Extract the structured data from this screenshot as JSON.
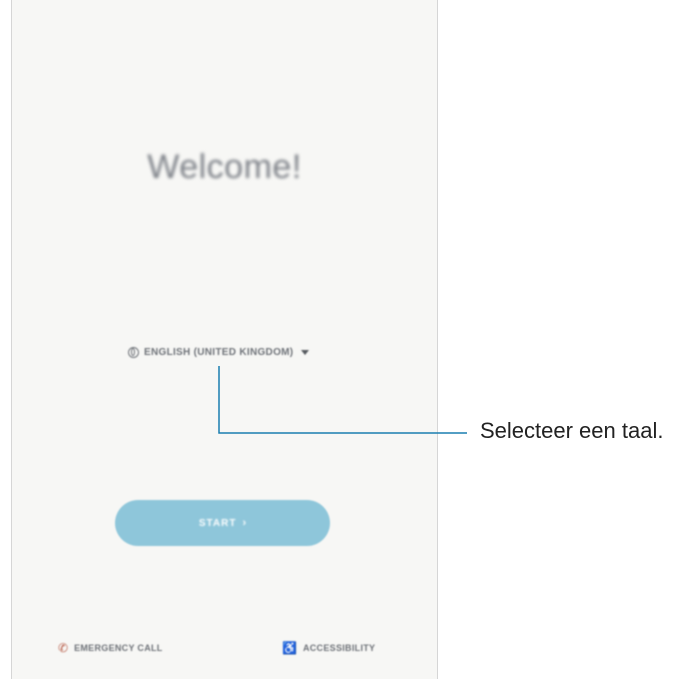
{
  "screen": {
    "welcome_title": "Welcome!",
    "language_selector": {
      "label": "ENGLISH (UNITED KINGDOM)",
      "icon": "globe-icon",
      "dropdown_icon": "dropdown-triangle-icon"
    },
    "start_button": {
      "label": "START",
      "icon": "chevron-right-icon",
      "color": "#8ec6da"
    },
    "bottom_actions": {
      "emergency_call": "EMERGENCY CALL",
      "accessibility": "ACCESSIBILITY"
    }
  },
  "callout": {
    "text": "Selecteer een taal.",
    "line_color": "#1a7fb0"
  }
}
